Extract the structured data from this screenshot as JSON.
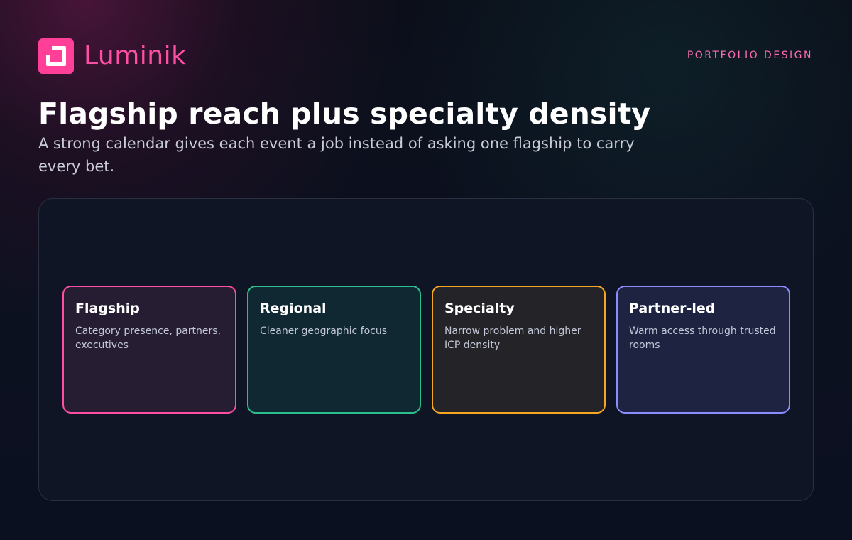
{
  "brand": {
    "name": "Luminik",
    "color": "#ff4fa5"
  },
  "header": {
    "kicker": "PORTFOLIO DESIGN",
    "title": "Flagship reach plus specialty density",
    "subtitle": "A strong calendar gives each event a job instead of asking one flagship to carry every bet."
  },
  "cards": [
    {
      "title": "Flagship",
      "description": "Category presence, partners, executives",
      "accent": "#ff4fa5"
    },
    {
      "title": "Regional",
      "description": "Cleaner geographic focus",
      "accent": "#2bbf8d"
    },
    {
      "title": "Specialty",
      "description": "Narrow problem and higher ICP density",
      "accent": "#f5a623"
    },
    {
      "title": "Partner-led",
      "description": "Warm access through trusted rooms",
      "accent": "#8b8cff"
    }
  ],
  "icons": {
    "brand_logo": "logo-icon"
  }
}
